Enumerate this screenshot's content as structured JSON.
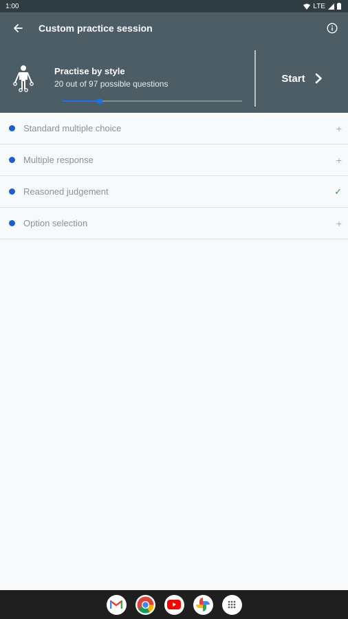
{
  "status_bar": {
    "time": "1:00",
    "network": "LTE"
  },
  "app_bar": {
    "title": "Custom practice session",
    "back_icon": "arrow-back-icon",
    "info_icon": "info-icon"
  },
  "panel": {
    "title": "Practise by style",
    "subtitle": "20 out of 97 possible questions",
    "slider_fraction": 0.21,
    "start_label": "Start",
    "accent": "#1a73e8",
    "background": "#4c5d65"
  },
  "styles": [
    {
      "label": "Standard multiple choice",
      "action": "+"
    },
    {
      "label": "Multiple response",
      "action": "+"
    },
    {
      "label": "Reasoned judgement",
      "action": "✓"
    },
    {
      "label": "Option selection",
      "action": "+"
    }
  ],
  "dock": [
    "gmail-icon",
    "chrome-icon",
    "youtube-icon",
    "photos-icon",
    "app-drawer-icon"
  ]
}
